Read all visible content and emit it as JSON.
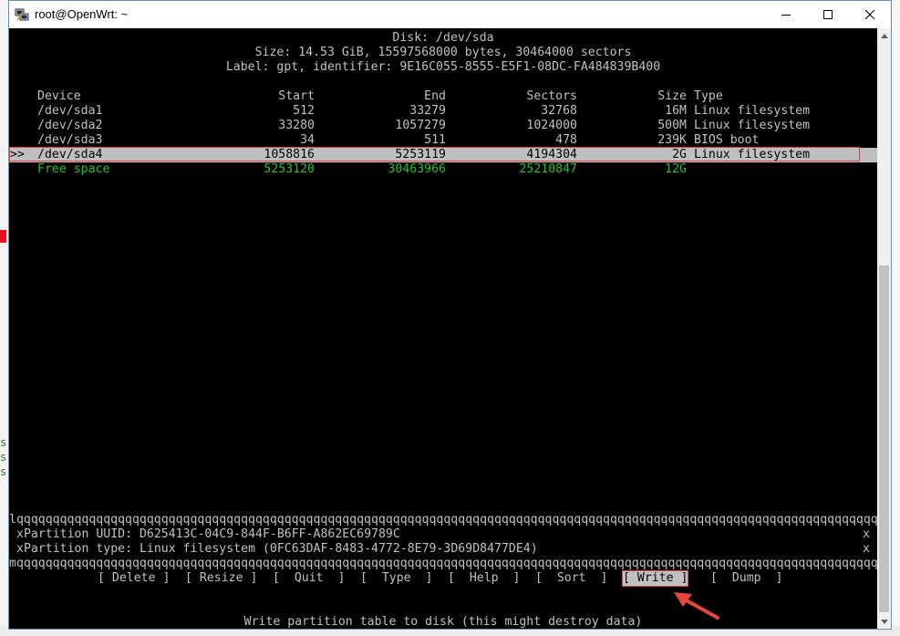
{
  "window": {
    "title": "root@OpenWrt: ~"
  },
  "icons": {
    "app": "putty-icon",
    "minimize": "minimize-icon",
    "maximize": "maximize-icon",
    "close": "close-icon"
  },
  "disk": {
    "title": "Disk: /dev/sda",
    "size_line": "Size: 14.53 GiB, 15597568000 bytes, 30464000 sectors",
    "label_line": "Label: gpt, identifier: 9E16C055-8555-E5F1-08DC-FA484839B400"
  },
  "table": {
    "headers": {
      "device": "Device",
      "start": "Start",
      "end": "End",
      "sectors": "Sectors",
      "size": "Size",
      "type": "Type"
    },
    "selection_marker": ">>",
    "rows": [
      {
        "device": "/dev/sda1",
        "start": "512",
        "end": "33279",
        "sectors": "32768",
        "size": "16M",
        "type": "Linux filesystem"
      },
      {
        "device": "/dev/sda2",
        "start": "33280",
        "end": "1057279",
        "sectors": "1024000",
        "size": "500M",
        "type": "Linux filesystem"
      },
      {
        "device": "/dev/sda3",
        "start": "34",
        "end": "511",
        "sectors": "478",
        "size": "239K",
        "type": "BIOS boot"
      },
      {
        "device": "/dev/sda4",
        "start": "1058816",
        "end": "5253119",
        "sectors": "4194304",
        "size": "2G",
        "type": "Linux filesystem"
      },
      {
        "device": "Free space",
        "start": "5253120",
        "end": "30463966",
        "sectors": "25210847",
        "size": "12G",
        "type": ""
      }
    ],
    "selected_index": 3
  },
  "info_box": {
    "top_border": "lqqqqqqqqqqqqqqqqqqqqqqqqqqqqqqqqqqqqqqqqqqqqqqqqqqqqqqqqqqqqqqqqqqqqqqqqqqqqqqqqqqqqqqqqqqqqqqqqqqqqqqqqqqqqqqqqqqqqqqqqqqqqqqqqqqqk",
    "uuid_line": "xPartition UUID: D625413C-04C9-844F-B6FF-A862EC69789C",
    "type_line": "xPartition type: Linux filesystem (0FC63DAF-8483-4772-8E79-3D69D8477DE4)",
    "right_edge": "x",
    "bottom_border": "mqqqqqqqqqqqqqqqqqqqqqqqqqqqqqqqqqqqqqqqqqqqqqqqqqqqqqqqqqqqqqqqqqqqqqqqqqqqqqqqqqqqqqqqqqqqqqqqqqqqqqqqqqqqqqqqqqqqqqqqqqqqqqqqqqqqj"
  },
  "menu": [
    {
      "label": "[ Delete ]"
    },
    {
      "label": "[ Resize ]"
    },
    {
      "label": "[  Quit  ]"
    },
    {
      "label": "[  Type  ]"
    },
    {
      "label": "[  Help  ]"
    },
    {
      "label": "[  Sort  ]"
    },
    {
      "label": "[ Write ]",
      "active": true
    },
    {
      "label": "[  Dump  ]"
    }
  ],
  "status_line": "Write partition table to disk (this might destroy data)",
  "colors": {
    "terminal_bg": "#000000",
    "terminal_fg": "#c0c0c0",
    "free_space": "#22c322",
    "highlight": "#c0c0c0",
    "annotation_arrow": "#e8463c"
  }
}
